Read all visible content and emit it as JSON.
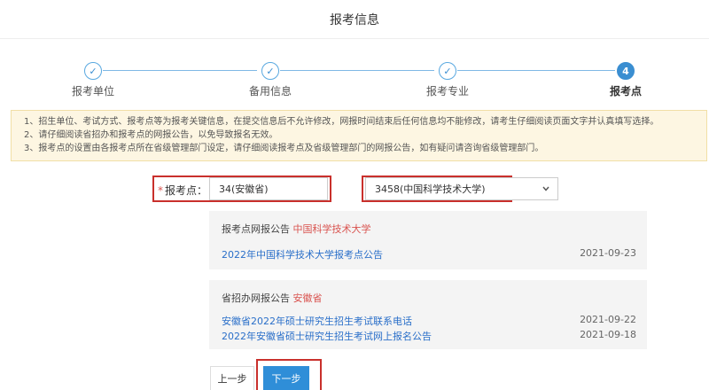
{
  "header": {
    "title": "报考信息"
  },
  "steps": [
    {
      "label": "报考单位",
      "state": "done",
      "icon": "check-icon"
    },
    {
      "label": "备用信息",
      "state": "done",
      "icon": "check-icon"
    },
    {
      "label": "报考专业",
      "state": "done",
      "icon": "check-icon"
    },
    {
      "label": "报考点",
      "state": "active",
      "number": "4"
    }
  ],
  "notice": {
    "lines": [
      "1、招生单位、考试方式、报考点等为报考关键信息，在提交信息后不允许修改，网报时间结束后任何信息均不能修改，请考生仔细阅读页面文字并认真填写选择。",
      "2、请仔细阅读省招办和报考点的网报公告，以免导致报名无效。",
      "3、报考点的设置由各报考点所在省级管理部门设定，请仔细阅读报考点及省级管理部门的网报公告，如有疑问请咨询省级管理部门。"
    ]
  },
  "form": {
    "required_mark": "*",
    "label": "报考点：",
    "province_value": "34(安徽省)",
    "site_value": "3458(中国科学技术大学)"
  },
  "site_notice": {
    "title_prefix": "报考点网报公告",
    "title_highlight": "中国科学技术大学",
    "items": [
      {
        "text": "2022年中国科学技术大学报考点公告",
        "date": "2021-09-23"
      }
    ]
  },
  "province_notice": {
    "title_prefix": "省招办网报公告",
    "title_highlight": "安徽省",
    "items": [
      {
        "text": "安徽省2022年硕士研究生招生考试联系电话",
        "date": "2021-09-22"
      },
      {
        "text": "2022年安徽省硕士研究生招生考试网上报名公告",
        "date": "2021-09-18"
      }
    ]
  },
  "buttons": {
    "prev": "上一步",
    "next": "下一步"
  },
  "colors": {
    "accent": "#2f8ed8",
    "highlight": "#c9302c",
    "link": "#2a6fc9",
    "notice_bg": "#fdf6e2"
  }
}
